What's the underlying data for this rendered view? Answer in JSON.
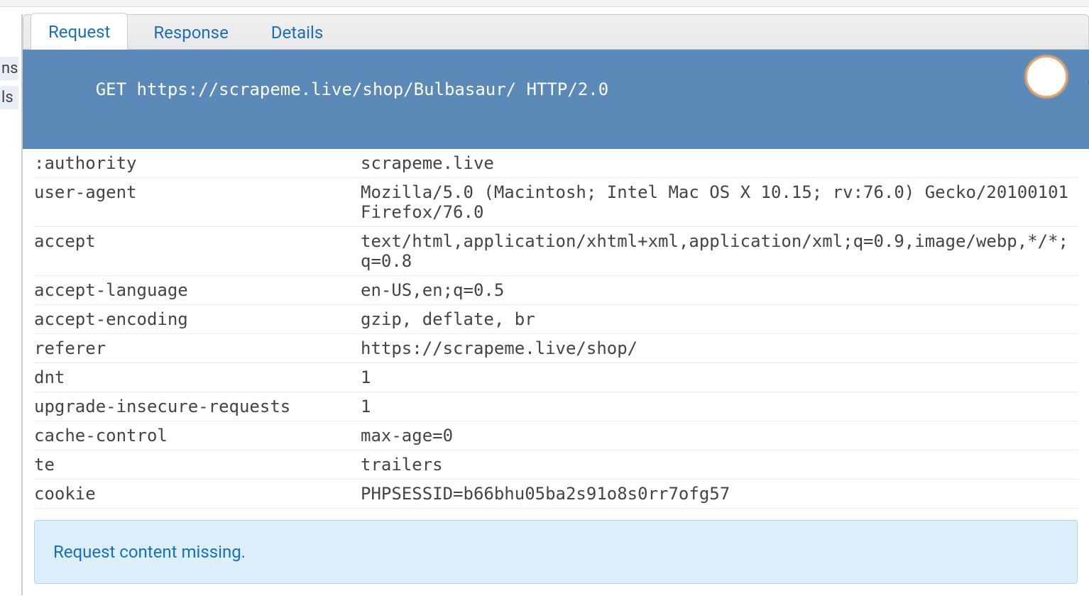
{
  "sidebar": {
    "item1": "ns",
    "item2": "ls"
  },
  "tabs": [
    {
      "label": "Request",
      "active": true
    },
    {
      "label": "Response",
      "active": false
    },
    {
      "label": "Details",
      "active": false
    }
  ],
  "request_line": "GET https://scrapeme.live/shop/Bulbasaur/ HTTP/2.0",
  "headers": [
    {
      "name": ":authority",
      "value": "scrapeme.live"
    },
    {
      "name": "user-agent",
      "value": "Mozilla/5.0 (Macintosh; Intel Mac OS X 10.15; rv:76.0) Gecko/20100101 Firefox/76.0"
    },
    {
      "name": "accept",
      "value": "text/html,application/xhtml+xml,application/xml;q=0.9,image/webp,*/*;q=0.8"
    },
    {
      "name": "accept-language",
      "value": "en-US,en;q=0.5"
    },
    {
      "name": "accept-encoding",
      "value": "gzip, deflate, br"
    },
    {
      "name": "referer",
      "value": "https://scrapeme.live/shop/"
    },
    {
      "name": "dnt",
      "value": "1"
    },
    {
      "name": "upgrade-insecure-requests",
      "value": "1"
    },
    {
      "name": "cache-control",
      "value": "max-age=0"
    },
    {
      "name": "te",
      "value": "trailers"
    },
    {
      "name": "cookie",
      "value": "PHPSESSID=b66bhu05ba2s91o8s0rr7ofg57"
    }
  ],
  "message": "Request content missing."
}
